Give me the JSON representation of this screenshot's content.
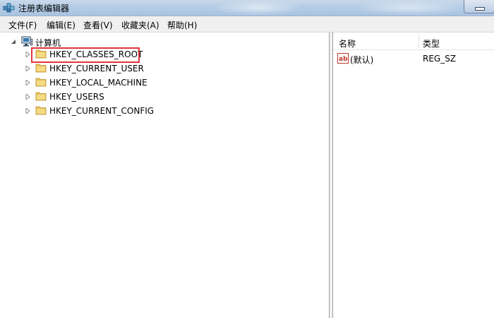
{
  "window": {
    "title": "注册表编辑器"
  },
  "menu": [
    "文件(F)",
    "编辑(E)",
    "查看(V)",
    "收藏夹(A)",
    "帮助(H)"
  ],
  "tree": {
    "root": "计算机",
    "keys": [
      "HKEY_CLASSES_ROOT",
      "HKEY_CURRENT_USER",
      "HKEY_LOCAL_MACHINE",
      "HKEY_USERS",
      "HKEY_CURRENT_CONFIG"
    ],
    "highlighted": "HKEY_CLASSES_ROOT"
  },
  "list": {
    "columns": {
      "name": "名称",
      "type": "类型"
    },
    "values": [
      {
        "name": "(默认)",
        "type": "REG_SZ",
        "icon": "string-value-icon"
      }
    ]
  },
  "colors": {
    "highlight_border": "#e0363f",
    "folder": "#e8c35a"
  }
}
